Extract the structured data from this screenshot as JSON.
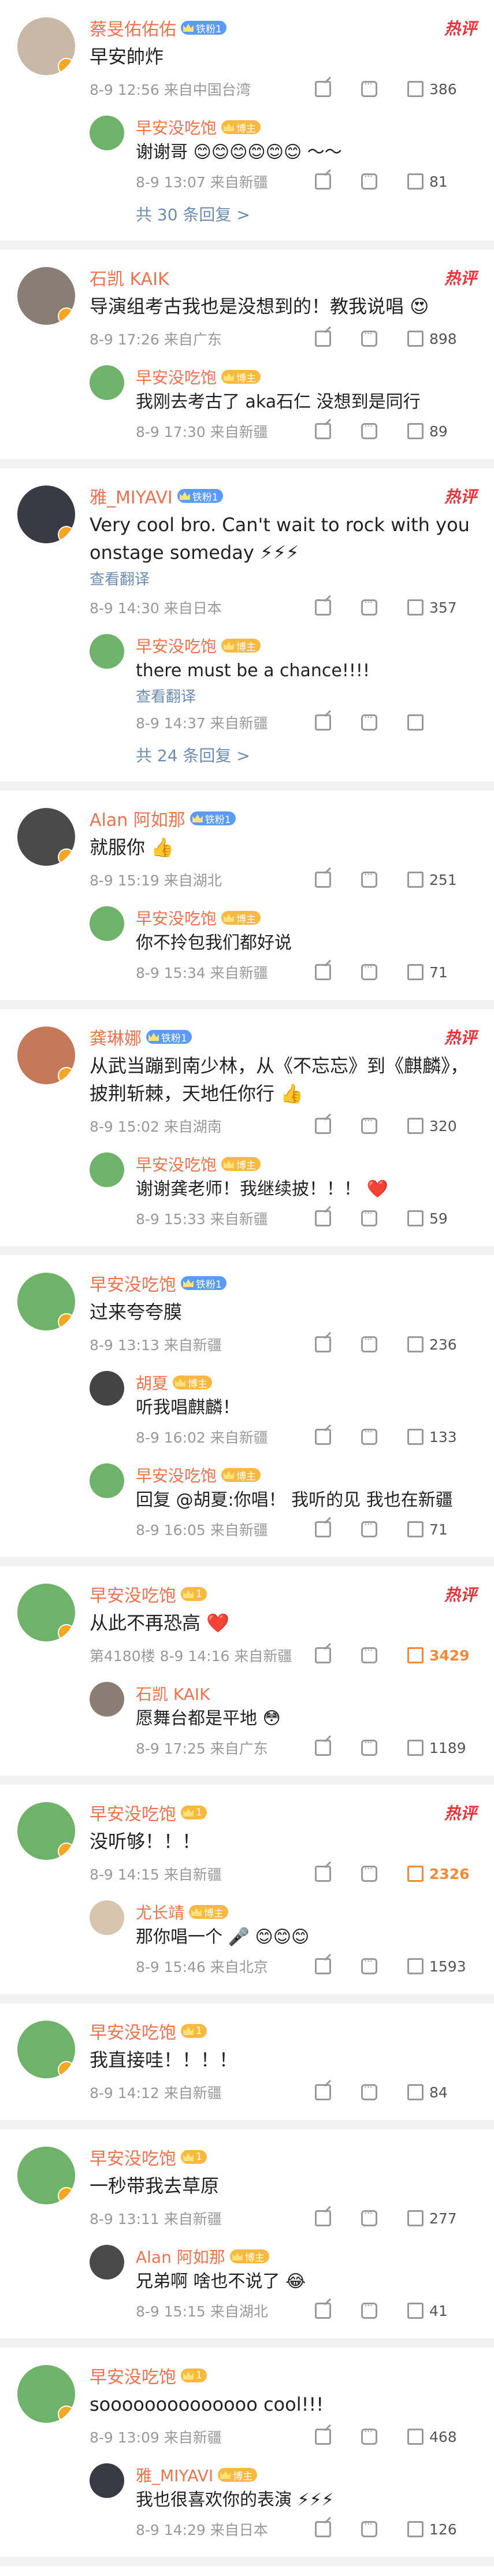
{
  "thread": [
    {
      "author": "蔡旻佑佑佑",
      "badge": "铁粉1",
      "badge_color": "blue",
      "hot": "热评",
      "text": "早安帥炸",
      "time": "8-9 12:56 来自中国台湾",
      "likes": "386",
      "likes_hot": false,
      "avatar_color": "#c9b8a6",
      "replies": [
        {
          "author": "早安没吃饱",
          "badge": "博主",
          "text": "谢谢哥 😊😊😊😊😊😊 ～～",
          "time": "8-9 13:07 来自新疆",
          "likes": "81",
          "avatar_color": "#6fb26a"
        }
      ],
      "more": "共 30 条回复 >"
    },
    {
      "author": "石凯 KAIK",
      "badge": "",
      "hot": "热评",
      "text": "导演组考古我也是没想到的！教我说唱 😍",
      "time": "8-9 17:26 来自广东",
      "likes": "898",
      "likes_hot": false,
      "avatar_color": "#8a7e74",
      "replies": [
        {
          "author": "早安没吃饱",
          "badge": "博主",
          "text": "我刚去考古了 aka石仁 没想到是同行",
          "time": "8-9 17:30 来自新疆",
          "likes": "89",
          "avatar_color": "#6fb26a"
        }
      ],
      "more": ""
    },
    {
      "author": "雅_MIYAVI",
      "badge": "铁粉1",
      "badge_color": "blue",
      "hot": "热评",
      "text": "Very cool bro. Can't wait to rock with you onstage someday ⚡⚡⚡",
      "translate": "查看翻译",
      "time": "8-9 14:30 来自日本",
      "likes": "357",
      "likes_hot": false,
      "avatar_color": "#3a3a44",
      "replies": [
        {
          "author": "早安没吃饱",
          "badge": "博主",
          "text": "there must be a chance!!!!",
          "translate": "查看翻译",
          "time": "8-9 14:37 来自新疆",
          "likes": "",
          "avatar_color": "#6fb26a"
        }
      ],
      "more": "共 24 条回复 >"
    },
    {
      "author": "Alan 阿如那",
      "badge": "铁粉1",
      "badge_color": "blue",
      "hot": "",
      "text": "就服你 👍",
      "time": "8-9 15:19 来自湖北",
      "likes": "251",
      "likes_hot": false,
      "avatar_color": "#4a4a4a",
      "replies": [
        {
          "author": "早安没吃饱",
          "badge": "博主",
          "text": "你不拎包我们都好说",
          "time": "8-9 15:34 来自新疆",
          "likes": "71",
          "avatar_color": "#6fb26a"
        }
      ],
      "more": ""
    },
    {
      "author": "龚琳娜",
      "badge": "铁粉1",
      "badge_color": "blue",
      "hot": "热评",
      "text": "从武当蹦到南少林，从《不忘忘》到《麒麟》，披荆斩棘，天地任你行 👍",
      "time": "8-9 15:02 来自湖南",
      "likes": "320",
      "likes_hot": false,
      "avatar_color": "#c47a5a",
      "replies": [
        {
          "author": "早安没吃饱",
          "badge": "博主",
          "text": "谢谢龚老师！我继续披！！！ ❤️",
          "time": "8-9 15:33 来自新疆",
          "likes": "59",
          "avatar_color": "#6fb26a"
        }
      ],
      "more": ""
    },
    {
      "author": "早安没吃饱",
      "badge": "铁粉1",
      "badge_color": "blue",
      "hot": "",
      "text": "过来夸夸膜",
      "time": "8-9 13:13 来自新疆",
      "likes": "236",
      "likes_hot": false,
      "avatar_color": "#6fb26a",
      "replies": [
        {
          "author": "胡夏",
          "badge": "博主",
          "text": "听我唱麒麟！",
          "time": "8-9 16:02 来自新疆",
          "likes": "133",
          "avatar_color": "#444"
        },
        {
          "author": "早安没吃饱",
          "badge": "博主",
          "text": "回复 @胡夏:你唱！ 我听的见 我也在新疆",
          "time": "8-9 16:05 来自新疆",
          "likes": "71",
          "avatar_color": "#6fb26a"
        }
      ],
      "more": ""
    },
    {
      "author": "早安没吃饱",
      "badge": "1",
      "badge_color": "gold",
      "hot": "热评",
      "text": "从此不再恐高 ❤️",
      "time": "第4180楼 8-9 14:16 来自新疆",
      "likes": "3429",
      "likes_hot": true,
      "avatar_color": "#6fb26a",
      "replies": [
        {
          "author": "石凯 KAIK",
          "badge": "",
          "text": "愿舞台都是平地 😳",
          "time": "8-9 17:25 来自广东",
          "likes": "1189",
          "avatar_color": "#8a7e74"
        }
      ],
      "more": ""
    },
    {
      "author": "早安没吃饱",
      "badge": "1",
      "badge_color": "gold",
      "hot": "热评",
      "text": "没听够！！！",
      "time": "8-9 14:15 来自新疆",
      "likes": "2326",
      "likes_hot": true,
      "avatar_color": "#6fb26a",
      "replies": [
        {
          "author": "尤长靖",
          "badge": "博主",
          "text": "那你唱一个 🎤 😊😊😊",
          "time": "8-9 15:46 来自北京",
          "likes": "1593",
          "avatar_color": "#d8c5b0"
        }
      ],
      "more": ""
    },
    {
      "author": "早安没吃饱",
      "badge": "1",
      "badge_color": "gold",
      "hot": "",
      "text": "我直接哇！！！！",
      "time": "8-9 14:12 来自新疆",
      "likes": "84",
      "likes_hot": false,
      "avatar_color": "#6fb26a",
      "replies": [],
      "more": ""
    },
    {
      "author": "早安没吃饱",
      "badge": "1",
      "badge_color": "gold",
      "hot": "",
      "text": "一秒带我去草原",
      "time": "8-9 13:11 来自新疆",
      "likes": "277",
      "likes_hot": false,
      "avatar_color": "#6fb26a",
      "replies": [
        {
          "author": "Alan 阿如那",
          "badge": "博主",
          "text": "兄弟啊 啥也不说了 😂",
          "time": "8-9 15:15 来自湖北",
          "likes": "41",
          "avatar_color": "#4a4a4a"
        }
      ],
      "more": ""
    },
    {
      "author": "早安没吃饱",
      "badge": "1",
      "badge_color": "gold",
      "hot": "",
      "text": "soooooooooooooo cool!!!",
      "time": "8-9 13:09 来自新疆",
      "likes": "468",
      "likes_hot": false,
      "avatar_color": "#6fb26a",
      "replies": [
        {
          "author": "雅_MIYAVI",
          "badge": "博主",
          "text": "我也很喜欢你的表演 ⚡⚡⚡",
          "time": "8-9 14:29 来自日本",
          "likes": "126",
          "avatar_color": "#3a3a44"
        }
      ],
      "more": ""
    }
  ]
}
